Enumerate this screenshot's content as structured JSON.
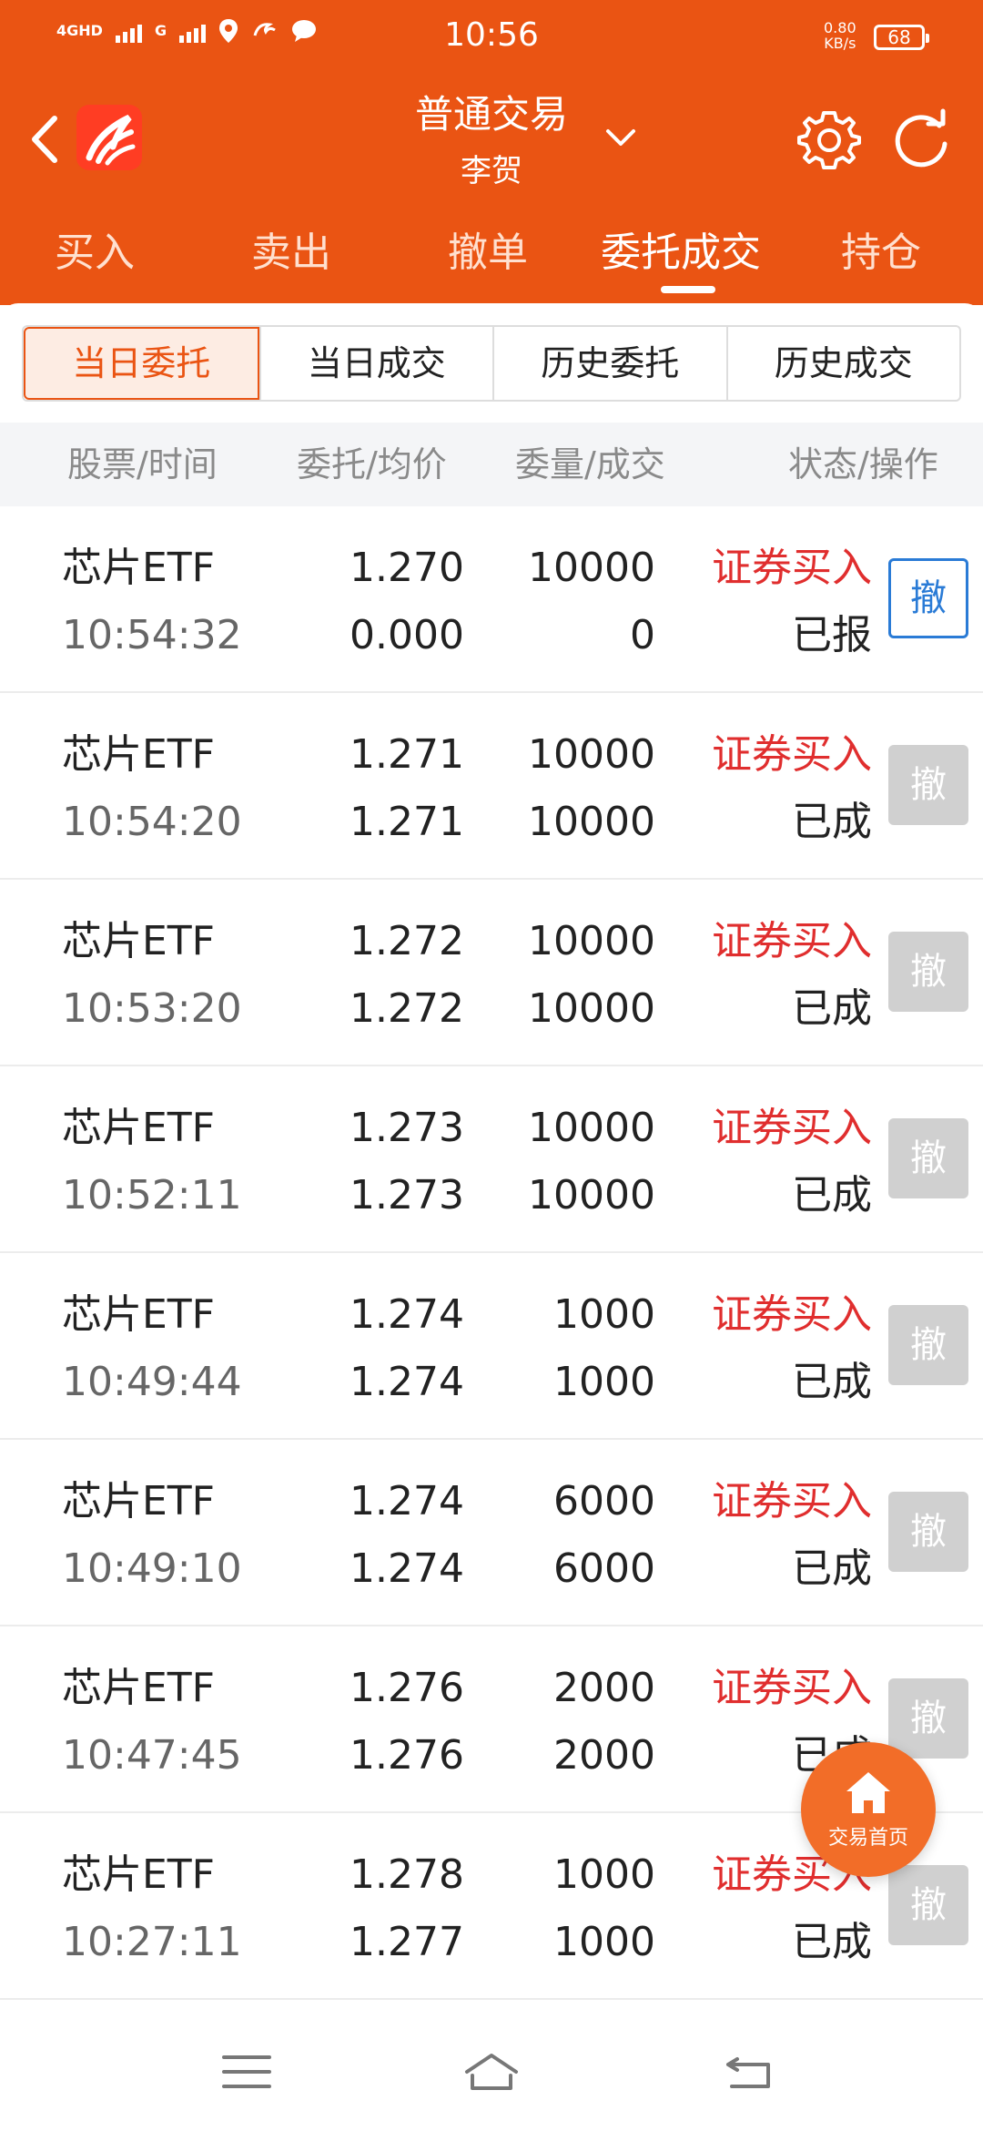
{
  "status_bar": {
    "network_1": "4GHD",
    "network_2": "G",
    "time": "10:56",
    "net_speed_value": "0.80",
    "net_speed_unit": "KB/s",
    "battery": "68"
  },
  "header": {
    "title": "普通交易",
    "subtitle": "李贺"
  },
  "main_tabs": [
    {
      "label": "买入"
    },
    {
      "label": "卖出"
    },
    {
      "label": "撤单"
    },
    {
      "label": "委托成交",
      "active": true
    },
    {
      "label": "持仓"
    }
  ],
  "sub_tabs": [
    {
      "label": "当日委托",
      "active": true
    },
    {
      "label": "当日成交"
    },
    {
      "label": "历史委托"
    },
    {
      "label": "历史成交"
    }
  ],
  "columns": [
    "股票/时间",
    "委托/均价",
    "委量/成交",
    "状态/操作"
  ],
  "orders": [
    {
      "name": "芯片ETF",
      "time": "10:54:32",
      "order_price": "1.270",
      "avg_price": "0.000",
      "order_qty": "10000",
      "filled_qty": "0",
      "action": "证券买入",
      "status": "已报",
      "cancel": "撤",
      "cancellable": true
    },
    {
      "name": "芯片ETF",
      "time": "10:54:20",
      "order_price": "1.271",
      "avg_price": "1.271",
      "order_qty": "10000",
      "filled_qty": "10000",
      "action": "证券买入",
      "status": "已成",
      "cancel": "撤",
      "cancellable": false
    },
    {
      "name": "芯片ETF",
      "time": "10:53:20",
      "order_price": "1.272",
      "avg_price": "1.272",
      "order_qty": "10000",
      "filled_qty": "10000",
      "action": "证券买入",
      "status": "已成",
      "cancel": "撤",
      "cancellable": false
    },
    {
      "name": "芯片ETF",
      "time": "10:52:11",
      "order_price": "1.273",
      "avg_price": "1.273",
      "order_qty": "10000",
      "filled_qty": "10000",
      "action": "证券买入",
      "status": "已成",
      "cancel": "撤",
      "cancellable": false
    },
    {
      "name": "芯片ETF",
      "time": "10:49:44",
      "order_price": "1.274",
      "avg_price": "1.274",
      "order_qty": "1000",
      "filled_qty": "1000",
      "action": "证券买入",
      "status": "已成",
      "cancel": "撤",
      "cancellable": false
    },
    {
      "name": "芯片ETF",
      "time": "10:49:10",
      "order_price": "1.274",
      "avg_price": "1.274",
      "order_qty": "6000",
      "filled_qty": "6000",
      "action": "证券买入",
      "status": "已成",
      "cancel": "撤",
      "cancellable": false
    },
    {
      "name": "芯片ETF",
      "time": "10:47:45",
      "order_price": "1.276",
      "avg_price": "1.276",
      "order_qty": "2000",
      "filled_qty": "2000",
      "action": "证券买入",
      "status": "已成",
      "cancel": "撤",
      "cancellable": false
    },
    {
      "name": "芯片ETF",
      "time": "10:27:11",
      "order_price": "1.278",
      "avg_price": "1.277",
      "order_qty": "1000",
      "filled_qty": "1000",
      "action": "证券买入",
      "status": "已成",
      "cancel": "撤",
      "cancellable": false
    }
  ],
  "fab": {
    "label": "交易首页",
    "icon": "home-icon"
  },
  "colors": {
    "brand": "#ea5413",
    "buy": "#e02e2e",
    "cancel_active": "#2a7bd6"
  }
}
